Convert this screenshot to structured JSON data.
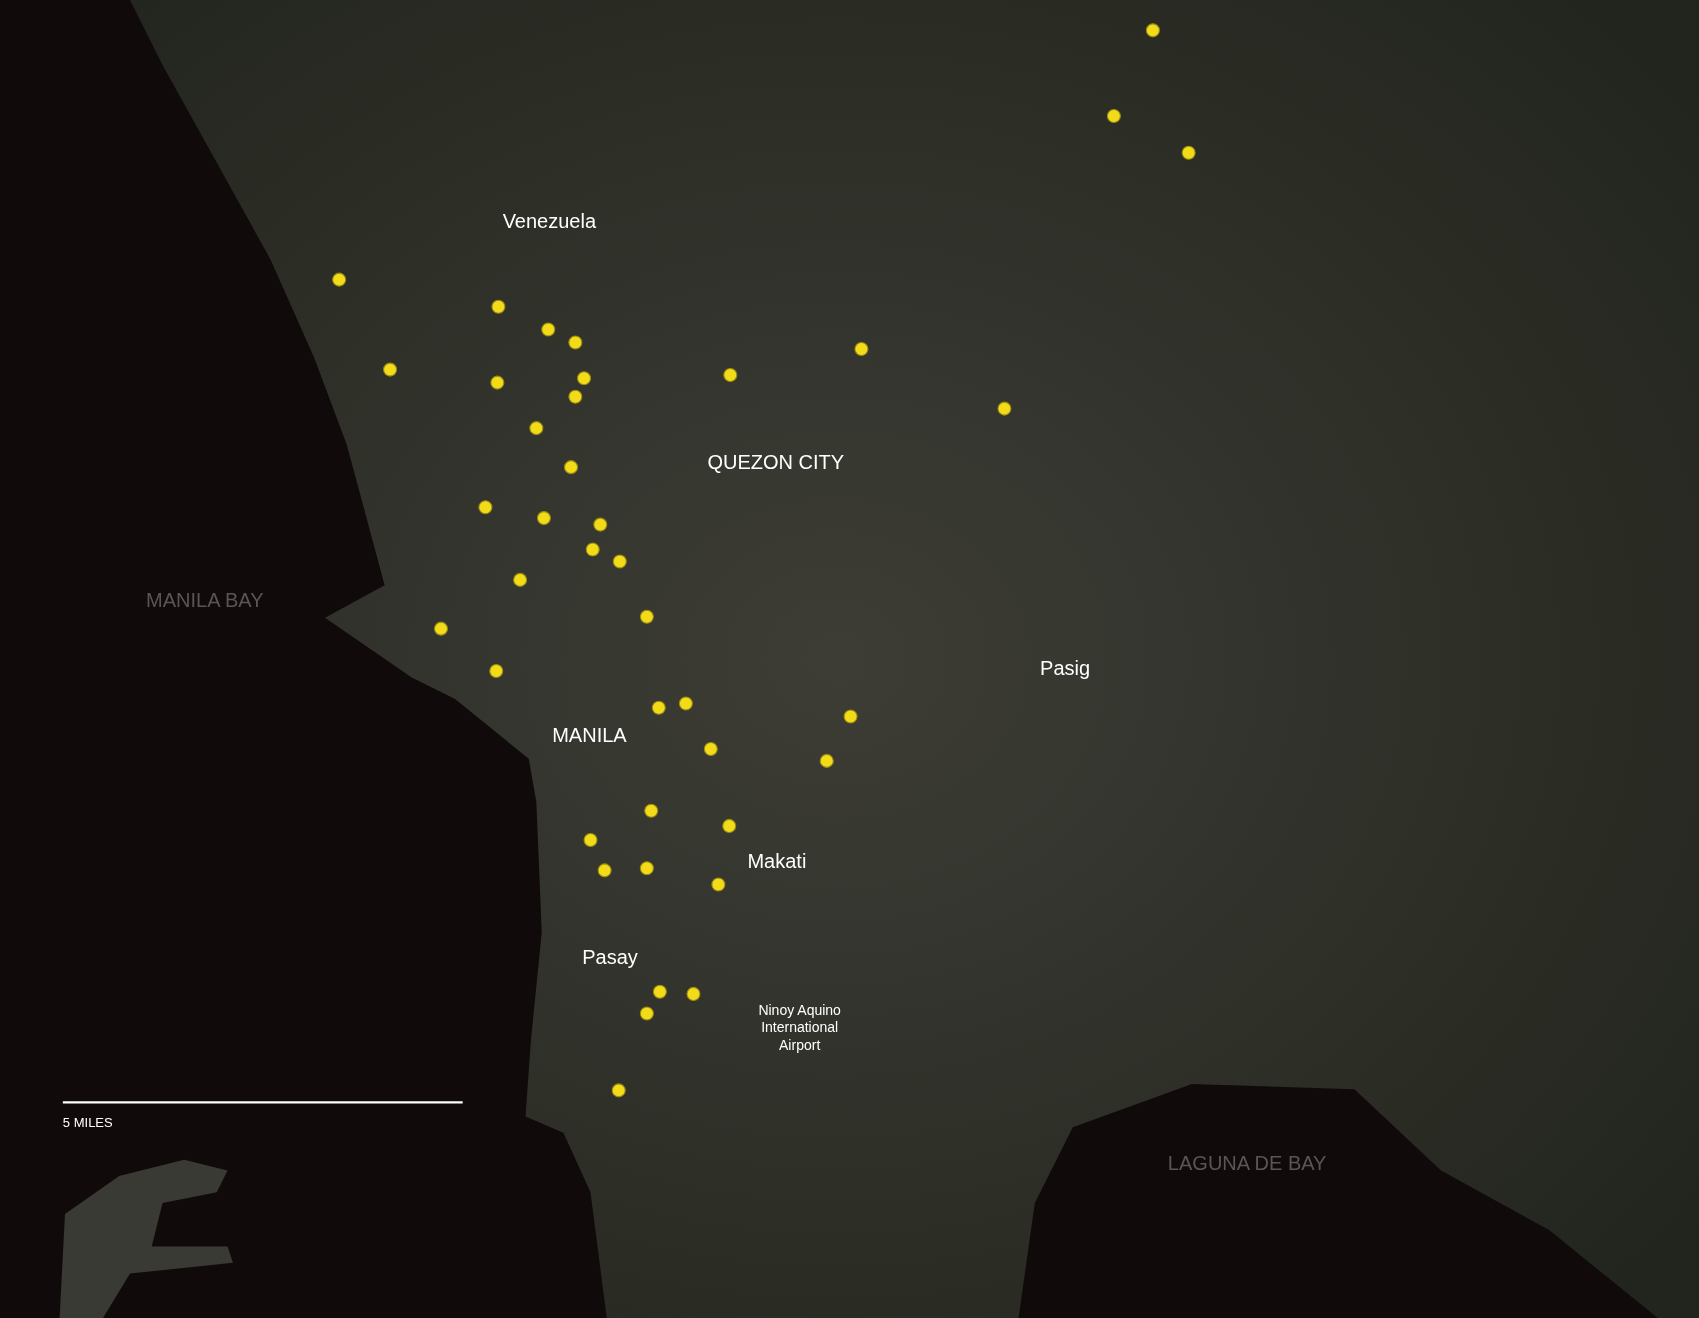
{
  "map": {
    "labels": [
      {
        "text": "Venezuela",
        "kind": "district"
      },
      {
        "text": "QUEZON CITY",
        "kind": "district"
      },
      {
        "text": "MANILA BAY",
        "kind": "water"
      },
      {
        "text": "Pasig",
        "kind": "district"
      },
      {
        "text": "MANILA",
        "kind": "district"
      },
      {
        "text": "Makati",
        "kind": "district"
      },
      {
        "text": "Pasay",
        "kind": "district"
      },
      {
        "text": "Ninoy Aquino International Airport",
        "kind": "landmark"
      },
      {
        "text": "LAGUNA DE BAY",
        "kind": "water"
      }
    ],
    "scale_bar": {
      "label": "5 MILES"
    }
  }
}
